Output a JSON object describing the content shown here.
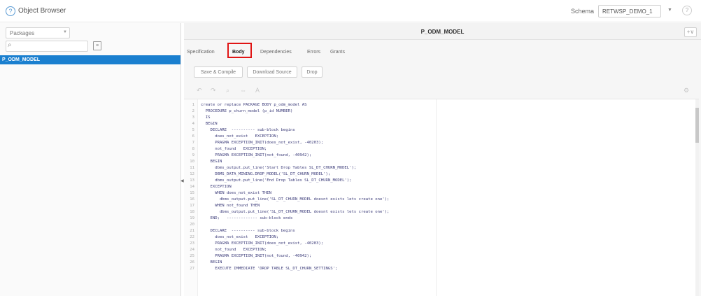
{
  "app": {
    "title": "Object Browser"
  },
  "schema": {
    "label": "Schema",
    "value": "RETWSP_DEMO_1"
  },
  "left": {
    "type_select": "Packages",
    "selected_object": "P_ODM_MODEL"
  },
  "object": {
    "title": "P_ODM_MODEL"
  },
  "tabs": [
    {
      "label": "Specification",
      "active": false
    },
    {
      "label": "Body",
      "active": true
    },
    {
      "label": "Dependencies",
      "active": false
    },
    {
      "label": "Errors",
      "active": false
    },
    {
      "label": "Grants",
      "active": false
    }
  ],
  "actions": [
    {
      "label": "Save & Compile"
    },
    {
      "label": "Download Source"
    },
    {
      "label": "Drop"
    }
  ],
  "code_lines": [
    {
      "n": "1",
      "text": "create or replace PACKAGE BODY p_odm_model AS"
    },
    {
      "n": "2",
      "text": "  PROCEDURE p_churn_model (p_id NUMBER)"
    },
    {
      "n": "3",
      "text": "  IS"
    },
    {
      "n": "4",
      "text": "  BEGIN"
    },
    {
      "n": "5",
      "text": "    DECLARE  ---------- sub-block begins"
    },
    {
      "n": "6",
      "text": "      does_not_exist   EXCEPTION;"
    },
    {
      "n": "7",
      "text": "      PRAGMA EXCEPTION_INIT(does_not_exist, -40203);"
    },
    {
      "n": "8",
      "text": "      not_found   EXCEPTION;"
    },
    {
      "n": "9",
      "text": "      PRAGMA EXCEPTION_INIT(not_found, -40942);"
    },
    {
      "n": "10",
      "text": "    BEGIN"
    },
    {
      "n": "11",
      "text": "      dbms_output.put_line('Start Drop Tables SL_DT_CHURN_MODEL');"
    },
    {
      "n": "12",
      "text": "      DBMS_DATA_MINING.DROP_MODEL('SL_DT_CHURN_MODEL');"
    },
    {
      "n": "13",
      "text": "      dbms_output.put_line('End Drop Tables SL_DT_CHURN_MODEL');"
    },
    {
      "n": "14",
      "text": "    EXCEPTION"
    },
    {
      "n": "15",
      "text": "      WHEN does_not_exist THEN"
    },
    {
      "n": "16",
      "text": "        dbms_output.put_line('SL_DT_CHURN_MODEL doesnt exists lets create one');"
    },
    {
      "n": "17",
      "text": "      WHEN not_found THEN"
    },
    {
      "n": "18",
      "text": "        dbms_output.put_line('SL_DT_CHURN_MODEL doesnt exists lets create one');"
    },
    {
      "n": "19",
      "text": "    END;   ------------- sub-block ends"
    },
    {
      "n": "20",
      "text": ""
    },
    {
      "n": "21",
      "text": "    DECLARE  ---------- sub-block begins"
    },
    {
      "n": "22",
      "text": "      does_not_exist   EXCEPTION;"
    },
    {
      "n": "23",
      "text": "      PRAGMA EXCEPTION_INIT(does_not_exist, -40203);"
    },
    {
      "n": "24",
      "text": "      not_found   EXCEPTION;"
    },
    {
      "n": "25",
      "text": "      PRAGMA EXCEPTION_INIT(not_found, -40942);"
    },
    {
      "n": "26",
      "text": "    BEGIN"
    },
    {
      "n": "27",
      "text": "      EXECUTE IMMEDIATE 'DROP TABLE SL_DT_CHURN_SETTINGS';"
    }
  ],
  "colors": {
    "accent": "#1a7fcf",
    "highlight": "#e01515"
  },
  "icons": [
    "search-icon",
    "filter-icon",
    "add-icon",
    "help-icon",
    "undo-icon",
    "redo-icon",
    "find-icon",
    "collapse-icon",
    "format-icon",
    "settings-icon"
  ]
}
